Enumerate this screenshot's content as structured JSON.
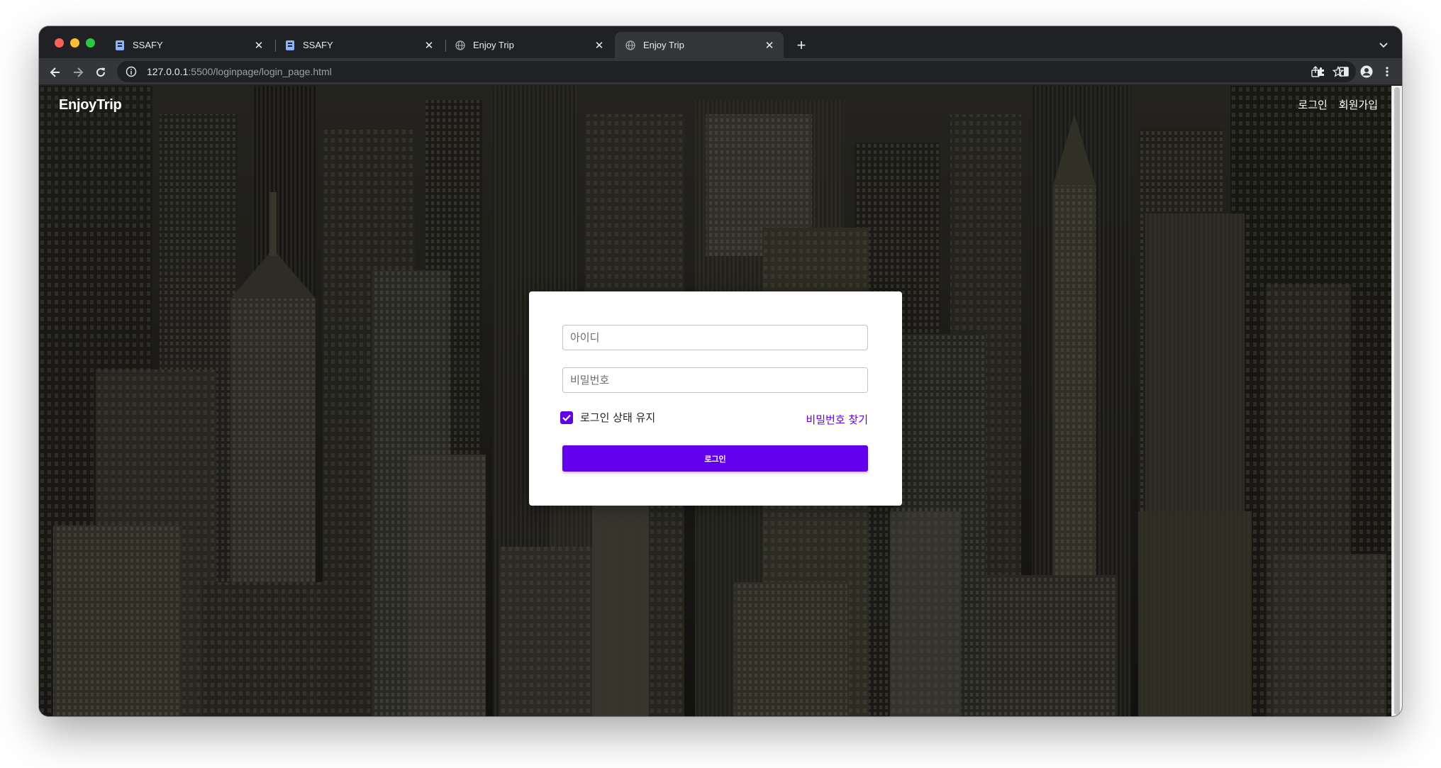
{
  "browser": {
    "tabs": [
      {
        "title": "SSAFY",
        "favicon": "ssafy-favicon",
        "active": false
      },
      {
        "title": "SSAFY",
        "favicon": "ssafy-favicon",
        "active": false
      },
      {
        "title": "Enjoy Trip",
        "favicon": "globe-icon",
        "active": false
      },
      {
        "title": "Enjoy Trip",
        "favicon": "globe-icon",
        "active": true
      }
    ],
    "url_host": "127.0.0.1",
    "url_rest": ":5500/loginpage/login_page.html"
  },
  "page": {
    "brand": "EnjoyTrip",
    "nav": {
      "login": "로그인",
      "signup": "회원가입"
    }
  },
  "login_form": {
    "id_placeholder": "아이디",
    "password_placeholder": "비밀번호",
    "remember_label": "로그인 상태 유지",
    "remember_checked": true,
    "find_password": "비밀번호 찾기",
    "submit_label": "로그인"
  },
  "colors": {
    "accent": "#6200ee",
    "chrome_dark": "#202124",
    "chrome_toolbar": "#35363a"
  }
}
